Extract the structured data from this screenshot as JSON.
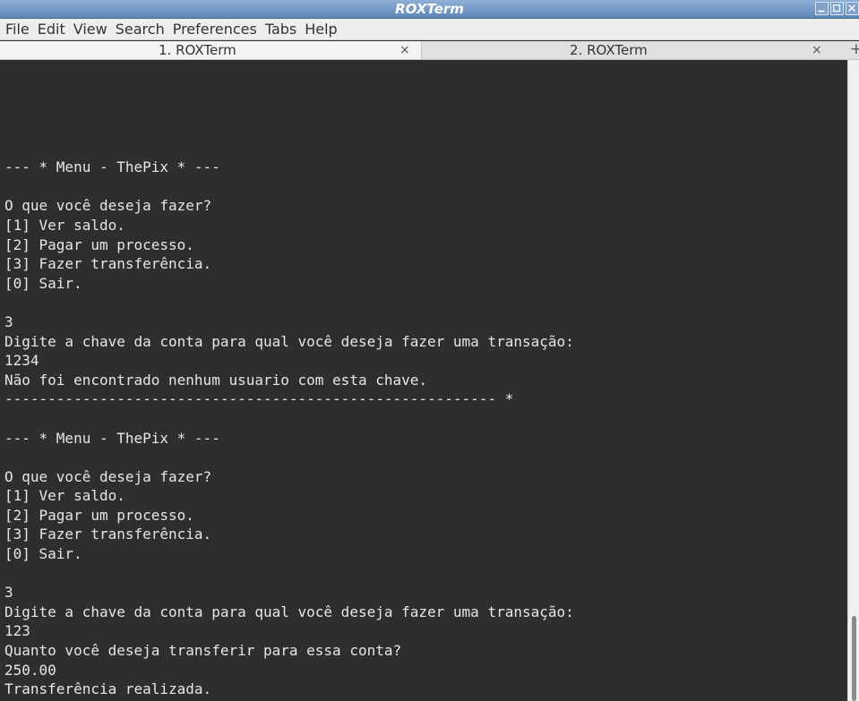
{
  "window": {
    "title": "ROXTerm"
  },
  "menubar": {
    "items": [
      "File",
      "Edit",
      "View",
      "Search",
      "Preferences",
      "Tabs",
      "Help"
    ]
  },
  "tabs": [
    {
      "label": "1. ROXTerm",
      "close": "×"
    },
    {
      "label": "2. ROXTerm",
      "close": "×"
    }
  ],
  "tab_add": "+",
  "terminal": {
    "lines": [
      "--- * Menu - ThePix * ---",
      "",
      "O que você deseja fazer?",
      "[1] Ver saldo.",
      "[2] Pagar um processo.",
      "[3] Fazer transferência.",
      "[0] Sair.",
      "",
      "3",
      "Digite a chave da conta para qual você deseja fazer uma transação:",
      "1234",
      "Não foi encontrado nenhum usuario com esta chave.",
      "--------------------------------------------------------- *",
      "",
      "--- * Menu - ThePix * ---",
      "",
      "O que você deseja fazer?",
      "[1] Ver saldo.",
      "[2] Pagar um processo.",
      "[3] Fazer transferência.",
      "[0] Sair.",
      "",
      "3",
      "Digite a chave da conta para qual você deseja fazer uma transação:",
      "123",
      "Quanto você deseja transferir para essa conta?",
      "250.00",
      "Transferência realizada."
    ]
  },
  "colors": {
    "terminal_bg": "#2e2e2e",
    "terminal_fg": "#e6e6e6",
    "titlebar": "#6f95c4"
  }
}
